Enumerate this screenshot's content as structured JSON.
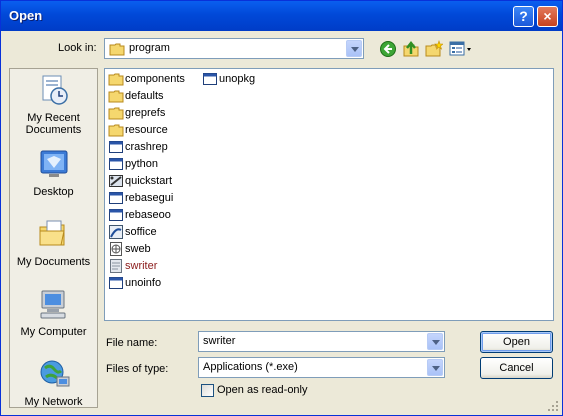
{
  "window": {
    "title": "Open"
  },
  "lookin": {
    "label": "Look in:",
    "value": "program"
  },
  "places": [
    {
      "id": "my-recent-documents",
      "label": "My Recent Documents"
    },
    {
      "id": "desktop",
      "label": "Desktop"
    },
    {
      "id": "my-documents",
      "label": "My Documents"
    },
    {
      "id": "my-computer",
      "label": "My Computer"
    },
    {
      "id": "my-network",
      "label": "My Network"
    }
  ],
  "files": [
    {
      "name": "components",
      "icon": "folder-icon"
    },
    {
      "name": "defaults",
      "icon": "folder-icon"
    },
    {
      "name": "greprefs",
      "icon": "folder-icon"
    },
    {
      "name": "resource",
      "icon": "folder-icon"
    },
    {
      "name": "crashrep",
      "icon": "app-window-icon"
    },
    {
      "name": "python",
      "icon": "app-window-icon"
    },
    {
      "name": "quickstart",
      "icon": "quickstart-icon"
    },
    {
      "name": "rebasegui",
      "icon": "app-window-icon"
    },
    {
      "name": "rebaseoo",
      "icon": "app-window-icon"
    },
    {
      "name": "soffice",
      "icon": "soffice-icon"
    },
    {
      "name": "sweb",
      "icon": "sweb-icon"
    },
    {
      "name": "swriter",
      "icon": "swriter-icon",
      "selected": true
    },
    {
      "name": "unoinfo",
      "icon": "app-window-icon"
    },
    {
      "name": "unopkg",
      "icon": "app-window-icon"
    }
  ],
  "filename": {
    "label": "File name:",
    "value": "swriter"
  },
  "filetype": {
    "label": "Files of type:",
    "value": "Applications (*.exe)"
  },
  "readonly": {
    "label": "Open as read-only",
    "checked": false
  },
  "buttons": {
    "open": "Open",
    "cancel": "Cancel"
  },
  "title_buttons": {
    "help": "?",
    "close": "×"
  }
}
